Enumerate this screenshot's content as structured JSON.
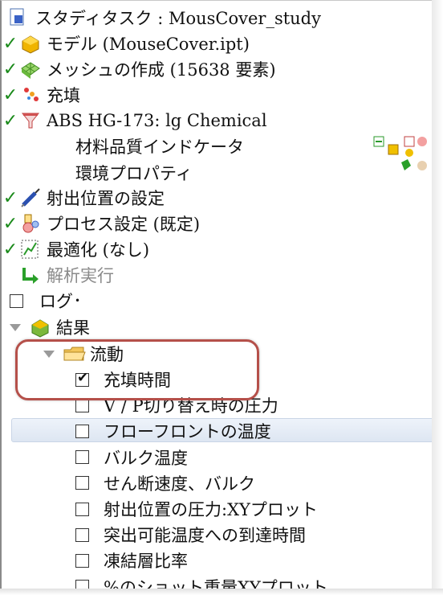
{
  "study": {
    "label": "スタディタスク : MousCover_study"
  },
  "tree": {
    "model": "モデル (MouseCover.ipt)",
    "mesh": "メッシュの作成 (15638 要素)",
    "fill": "充填",
    "material": "ABS HG-173: lg Chemical",
    "material_quality": "材料品質インドケータ",
    "env_props": "環境プロパティ",
    "injection": "射出位置の設定",
    "process": "プロセス設定 (既定)",
    "optimize": "最適化 (なし)",
    "run": "解析実行",
    "log": "ログ",
    "results": "結果",
    "flow": "流動"
  },
  "results_items": [
    {
      "label": "充填時間",
      "checked": true
    },
    {
      "label": "V / P切り替え時の圧力",
      "checked": false
    },
    {
      "label": "フローフロントの温度",
      "checked": false
    },
    {
      "label": "バルク温度",
      "checked": false
    },
    {
      "label": "せん断速度、バルク",
      "checked": false
    },
    {
      "label": "射出位置の圧力:XYプロット",
      "checked": false
    },
    {
      "label": "突出可能温度への到達時間",
      "checked": false
    },
    {
      "label": "凍結層比率",
      "checked": false
    },
    {
      "label": "%のショット重量XYプロット",
      "checked": false
    }
  ],
  "icons": {
    "study": "study-icon",
    "model": "model-cube-icon",
    "mesh": "mesh-icon",
    "fill": "fill-dots-icon",
    "material": "funnel-icon",
    "injection": "syringe-icon",
    "process": "process-flask-icon",
    "optimize": "chart-icon",
    "run": "run-arrow-icon",
    "results": "results-cube-icon",
    "flow": "folder-icon"
  },
  "colors": {
    "check_green": "#1a8a1a",
    "highlight": "#b5504a",
    "selected_row": "#dde6f2"
  }
}
